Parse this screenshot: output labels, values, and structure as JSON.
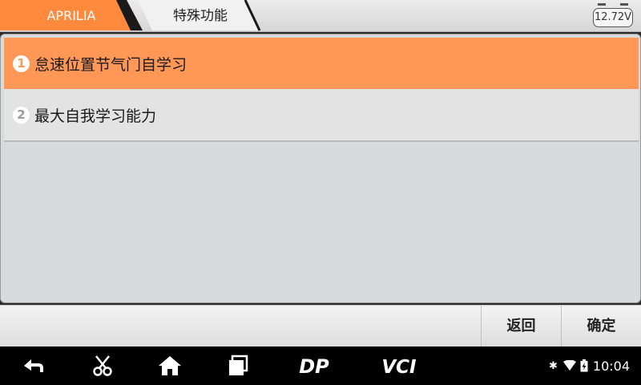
{
  "breadcrumb": {
    "brand": "APRILIA",
    "function": "特殊功能",
    "brand_color": "#ff8a3d"
  },
  "battery": {
    "voltage": "12.72V"
  },
  "menu": {
    "items": [
      {
        "number": "1",
        "label": "怠速位置节气门自学习",
        "selected": true
      },
      {
        "number": "2",
        "label": "最大自我学习能力",
        "selected": false
      }
    ]
  },
  "actions": {
    "back_label": "返回",
    "ok_label": "确定"
  },
  "nav": {
    "icons": [
      "back-arrow-icon",
      "scissors-icon",
      "home-icon",
      "recent-apps-icon",
      "dp-icon",
      "vci-icon"
    ],
    "dp_label": "DP",
    "vci_label": "VCI"
  },
  "status": {
    "icons": [
      "bluetooth-icon",
      "wifi-icon",
      "battery-charging-icon"
    ],
    "time": "10:04"
  },
  "colors": {
    "selected_row": "#ff9856",
    "panel_bg": "#d8dadb",
    "navbar_bg": "#000000"
  }
}
